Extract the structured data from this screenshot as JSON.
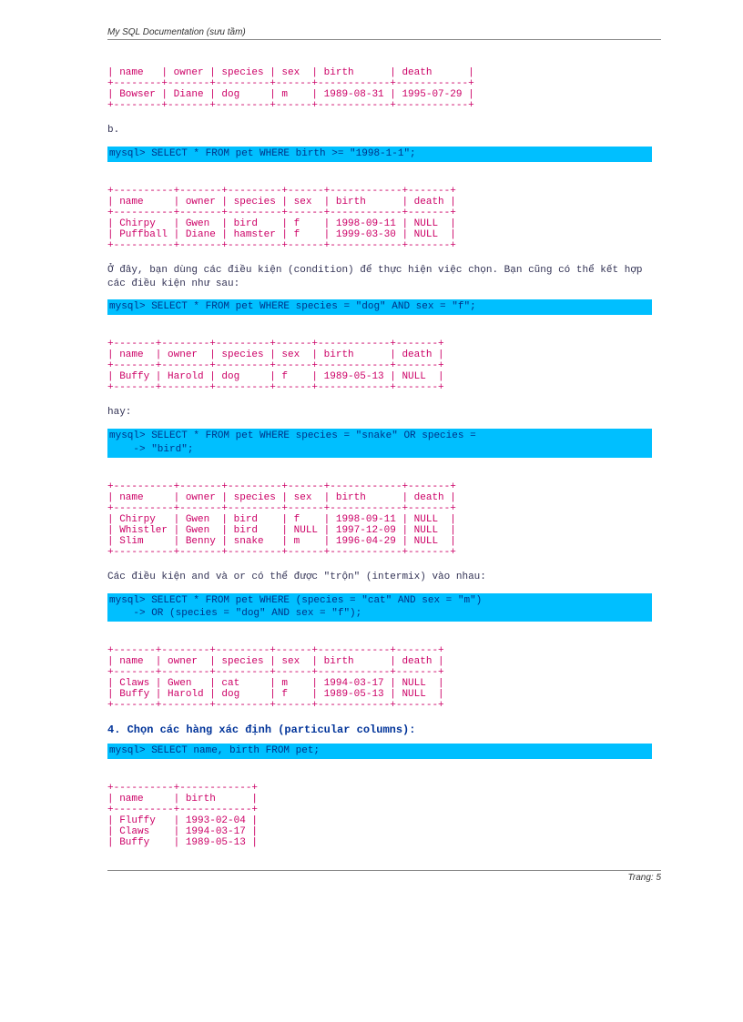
{
  "header": {
    "title": "My SQL Documentation (sưu tầm)"
  },
  "table1": {
    "sep": "+--------+-------+---------+------+------------+------------+",
    "hdr": "| name   | owner | species | sex  | birth      | death      |",
    "row1": "| Bowser | Diane | dog     | m    | 1989-08-31 | 1995-07-29 |"
  },
  "label_b": "b.",
  "sql1": "mysql> SELECT * FROM pet WHERE birth >= \"1998-1-1\";",
  "table2": {
    "sep": "+----------+-------+---------+------+------------+-------+",
    "hdr": "| name     | owner | species | sex  | birth      | death |",
    "row1": "| Chirpy   | Gwen  | bird    | f    | 1998-09-11 | NULL  |",
    "row2": "| Puffball | Diane | hamster | f    | 1999-03-30 | NULL  |"
  },
  "para1": "Ở đây, bạn dùng các điều kiện (condition) để thực hiện việc chọn. Bạn cũng có thể kết hợp các điều kiện như sau:",
  "sql2": "mysql> SELECT * FROM pet WHERE species = \"dog\" AND sex = \"f\";",
  "table3": {
    "sep": "+-------+--------+---------+------+------------+-------+",
    "hdr": "| name  | owner  | species | sex  | birth      | death |",
    "row1": "| Buffy | Harold | dog     | f    | 1989-05-13 | NULL  |"
  },
  "label_hay": "hay:",
  "sql3a": "mysql> SELECT * FROM pet WHERE species = \"snake\" OR species =",
  "sql3b": "    -> \"bird\";",
  "table4": {
    "sep": "+----------+-------+---------+------+------------+-------+",
    "hdr": "| name     | owner | species | sex  | birth      | death |",
    "row1": "| Chirpy   | Gwen  | bird    | f    | 1998-09-11 | NULL  |",
    "row2": "| Whistler | Gwen  | bird    | NULL | 1997-12-09 | NULL  |",
    "row3": "| Slim     | Benny | snake   | m    | 1996-04-29 | NULL  |"
  },
  "para2": "Các điều kiện and và or có thể được \"trộn\" (intermix) vào nhau:",
  "sql4a": "mysql> SELECT * FROM pet WHERE (species = \"cat\" AND sex = \"m\")",
  "sql4b": "    -> OR (species = \"dog\" AND sex = \"f\");",
  "table5": {
    "sep": "+-------+--------+---------+------+------------+-------+",
    "hdr": "| name  | owner  | species | sex  | birth      | death |",
    "row1": "| Claws | Gwen   | cat     | m    | 1994-03-17 | NULL  |",
    "row2": "| Buffy | Harold | dog     | f    | 1989-05-13 | NULL  |"
  },
  "heading4": "4. Chọn các hàng xác định (particular columns):",
  "sql5": "mysql> SELECT name, birth FROM pet;",
  "table6": {
    "sep": "+----------+------------+",
    "hdr": "| name     | birth      |",
    "row1": "| Fluffy   | 1993-02-04 |",
    "row2": "| Claws    | 1994-03-17 |",
    "row3": "| Buffy    | 1989-05-13 |"
  },
  "footer": {
    "page": "Trang: 5"
  }
}
